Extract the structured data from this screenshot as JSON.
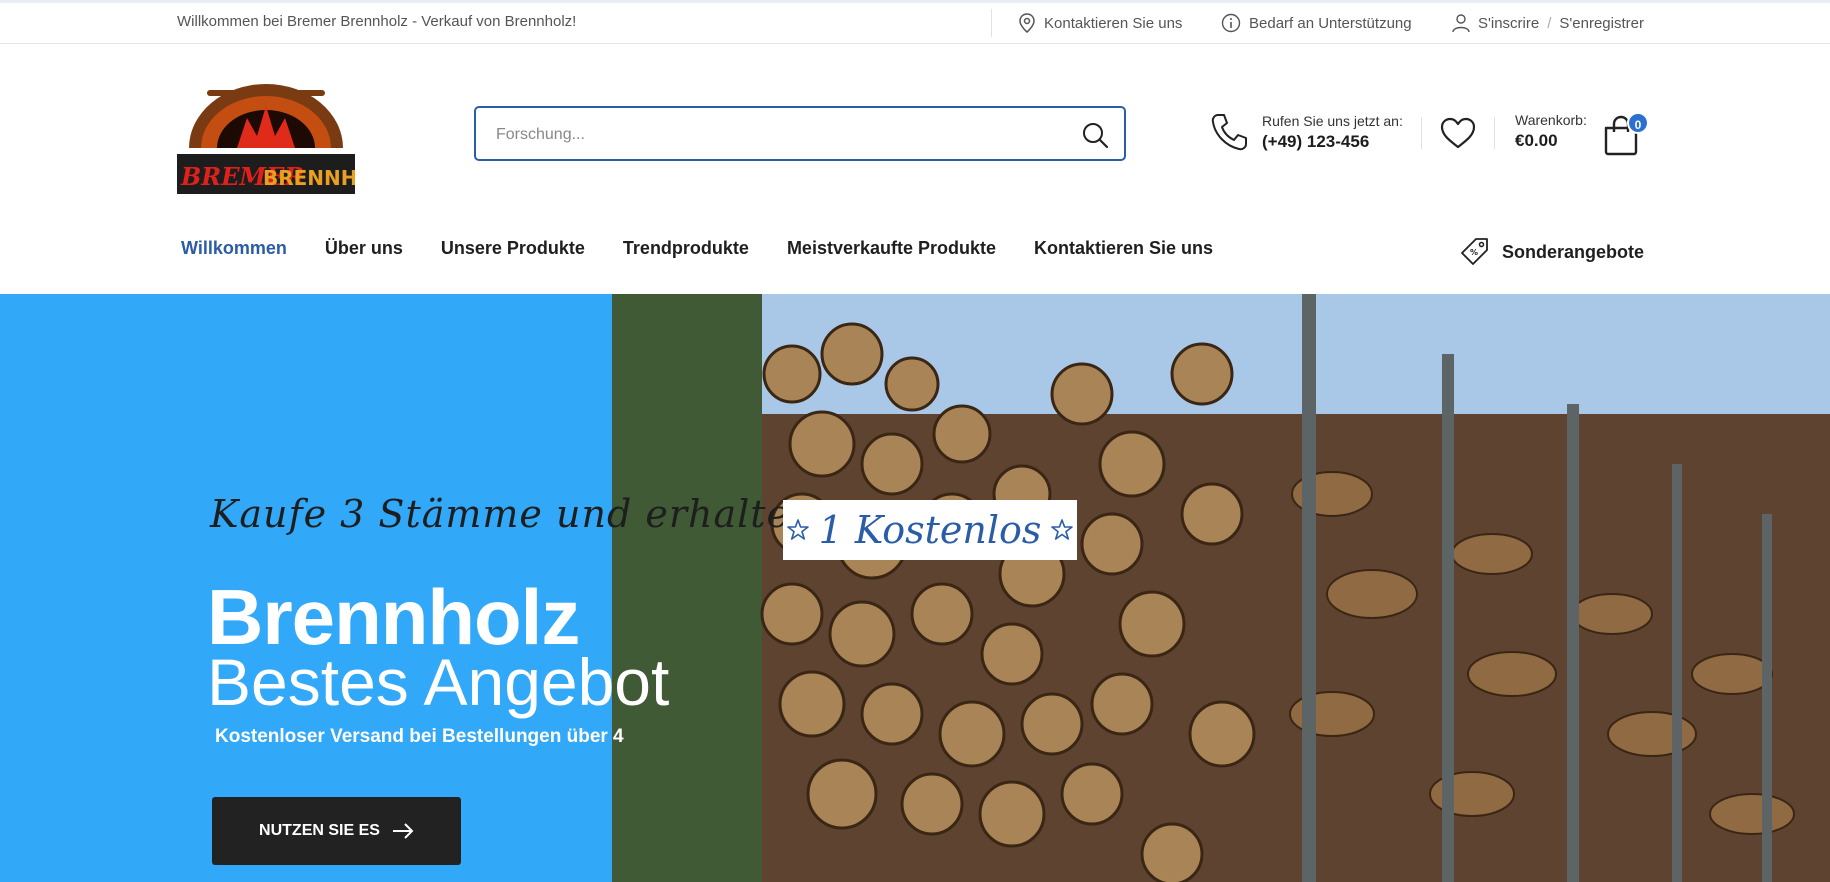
{
  "topbar": {
    "welcome": "Willkommen bei Bremer Brennholz - Verkauf von Brennholz!",
    "contact": "Kontaktieren Sie uns",
    "support": "Bedarf an Unterstützung",
    "signin": "S'inscrire",
    "divider": "/",
    "register": "S'enregistrer"
  },
  "logo": {
    "left_text": "BREMER",
    "right_text": "BRENNHOLZ"
  },
  "search": {
    "placeholder": "Forschung..."
  },
  "call": {
    "label": "Rufen Sie uns jetzt an:",
    "number": "(+49) 123-456"
  },
  "cart": {
    "label": "Warenkorb:",
    "amount": "€0.00",
    "count": "0"
  },
  "nav": {
    "items": [
      "Willkommen",
      "Über uns",
      "Unsere Produkte",
      "Trendprodukte",
      "Meistverkaufte Produkte",
      "Kontaktieren Sie uns"
    ],
    "deals": "Sonderangebote"
  },
  "hero": {
    "script_line": "Kaufe 3 Stämme und erhalte",
    "free_badge": "1 Kostenlos",
    "title": "Brennholz",
    "subtitle": "Bestes Angebot",
    "note": "Kostenloser Versand bei Bestellungen über 4",
    "cta": "NUTZEN SIE ES"
  },
  "colors": {
    "accent": "#2a5ca8",
    "hero_blue": "#32a8f8",
    "button_dark": "#222222"
  }
}
